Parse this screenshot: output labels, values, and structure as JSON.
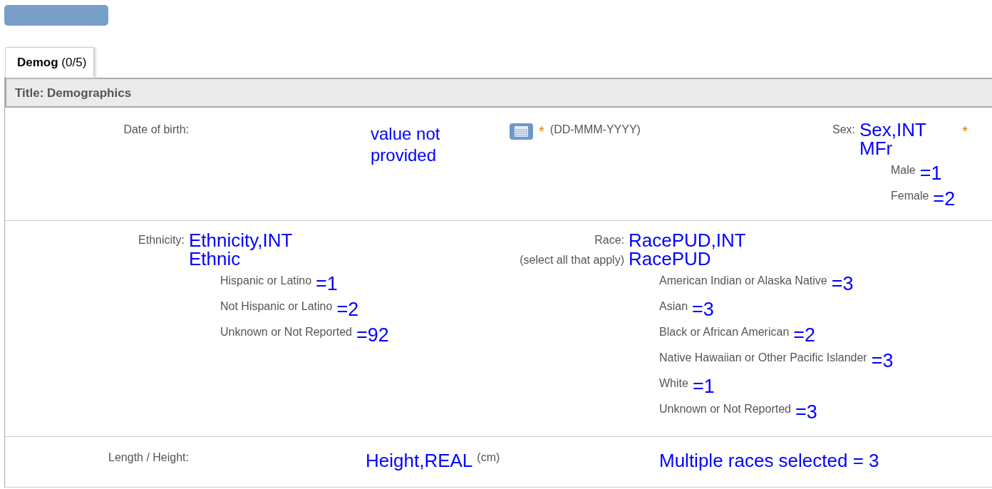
{
  "tabs": [
    {
      "label": "**Demog** (0/5)",
      "selected": true
    }
  ],
  "title": "Title: Demographics",
  "date_of_birth": {
    "label": "Date of birth:",
    "value": "value not provided",
    "required": "*",
    "format": "(DD-MMM-YYYY)"
  },
  "sex": {
    "label": "Sex:",
    "variable": "Sex,INT",
    "code": "MFr",
    "required": "*",
    "options": [
      {
        "label": "Male",
        "code": "=1"
      },
      {
        "label": "Female",
        "code": "=2"
      }
    ]
  },
  "ethnicity": {
    "label": "Ethnicity:",
    "variable": "Ethnicity,INT",
    "code": "Ethnic",
    "options": [
      {
        "label": "Hispanic or Latino",
        "code": "=1"
      },
      {
        "label": "Not Hispanic or Latino",
        "code": "=2"
      },
      {
        "label": "Unknown or Not Reported",
        "code": "=92"
      }
    ]
  },
  "race": {
    "label": "Race:",
    "hint": "(select all that apply)",
    "variable": "RacePUD,INT",
    "code": "RacePUD",
    "options": [
      {
        "label": "American Indian or Alaska Native",
        "code": "=3"
      },
      {
        "label": "Asian",
        "code": "=3"
      },
      {
        "label": "Black or African American",
        "code": "=2"
      },
      {
        "label": "Native Hawaiian or Other Pacific Islander",
        "code": "=3"
      },
      {
        "label": "White",
        "code": "=1"
      },
      {
        "label": "Unknown or Not Reported",
        "code": "=3"
      }
    ]
  },
  "height": {
    "label": "Length / Height:",
    "variable": "Height,REAL",
    "unit": "(cm)",
    "note": "Multiple races selected = 3"
  }
}
